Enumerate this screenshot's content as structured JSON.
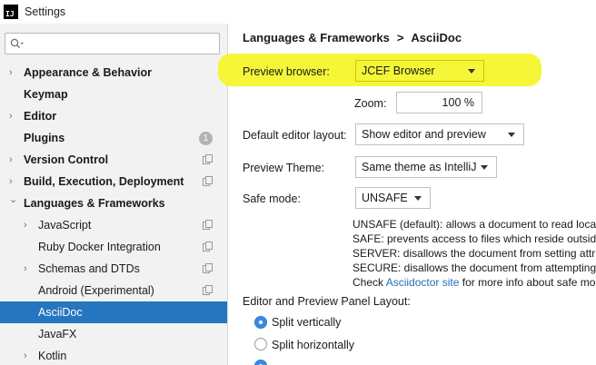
{
  "window": {
    "title": "Settings",
    "app_icon": "intellij-icon"
  },
  "search": {
    "value": "",
    "placeholder": "",
    "icon": "search-icon"
  },
  "sidebar": {
    "items": [
      {
        "label": "Appearance & Behavior",
        "bold": true,
        "expandable": true,
        "expanded": false
      },
      {
        "label": "Keymap",
        "bold": true
      },
      {
        "label": "Editor",
        "bold": true,
        "expandable": true,
        "expanded": false
      },
      {
        "label": "Plugins",
        "bold": true,
        "badge": "1"
      },
      {
        "label": "Version Control",
        "bold": true,
        "expandable": true,
        "expanded": false
      },
      {
        "label": "Build, Execution, Deployment",
        "bold": true,
        "expandable": true,
        "expanded": false
      },
      {
        "label": "Languages & Frameworks",
        "bold": true,
        "expandable": true,
        "expanded": true
      },
      {
        "label": "JavaScript",
        "expandable": true,
        "expanded": false
      },
      {
        "label": "Ruby Docker Integration"
      },
      {
        "label": "Schemas and DTDs",
        "expandable": true,
        "expanded": false
      },
      {
        "label": "Android (Experimental)"
      },
      {
        "label": "AsciiDoc",
        "selected": true
      },
      {
        "label": "JavaFX"
      },
      {
        "label": "Kotlin",
        "expandable": true,
        "expanded": false
      }
    ]
  },
  "breadcrumb": {
    "parent": "Languages & Frameworks",
    "current": "AsciiDoc"
  },
  "form": {
    "preview_browser_label": "Preview browser:",
    "preview_browser_value": "JCEF Browser",
    "zoom_label": "Zoom:",
    "zoom_value": "100 %",
    "layout_label": "Default editor layout:",
    "layout_value": "Show editor and preview",
    "theme_label": "Preview Theme:",
    "theme_value": "Same theme as IntelliJ",
    "safe_mode_label": "Safe mode:",
    "safe_mode_value": "UNSAFE",
    "safe_desc": {
      "unsafe": "UNSAFE (default): allows a document to read local",
      "safe": "SAFE: prevents access to files which reside outside c",
      "server": "SERVER: disallows the document from setting attrib",
      "secure": "SECURE: disallows the document from attempting t",
      "check_prefix": "Check",
      "check_link": "Asciidoctor site",
      "check_suffix": "for more info about safe mo"
    },
    "panel_layout_label": "Editor and Preview Panel Layout:",
    "radio_options": [
      {
        "label": "Split vertically",
        "checked": true
      },
      {
        "label": "Split horizontally",
        "checked": false
      }
    ]
  },
  "colors": {
    "selection": "#2675bf",
    "highlight": "#f4f52c",
    "link": "#2470b3"
  }
}
